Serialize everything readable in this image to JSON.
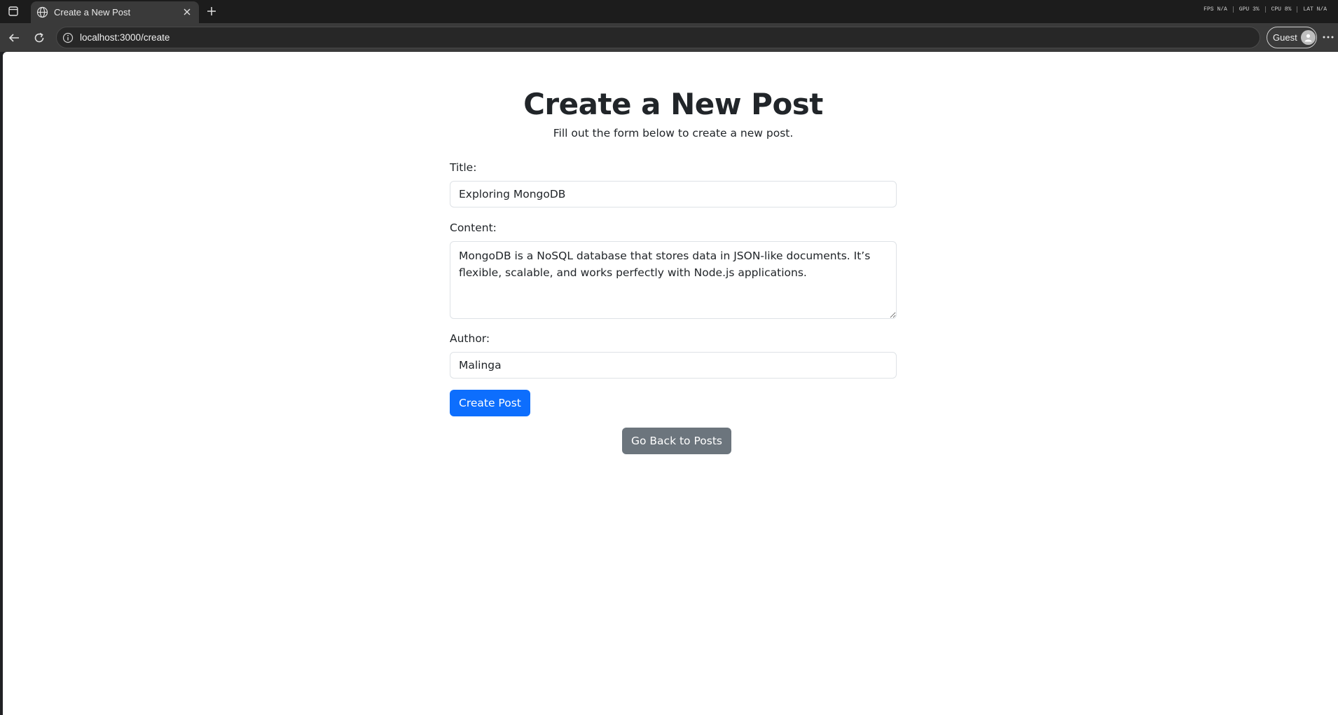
{
  "browser": {
    "tab_title": "Create a New Post",
    "url": "localhost:3000/create",
    "guest_label": "Guest",
    "stats": [
      "FPS N/A",
      "GPU 3%",
      "CPU 8%",
      "LAT N/A"
    ]
  },
  "page": {
    "heading": "Create a New Post",
    "subheading": "Fill out the form below to create a new post.",
    "form": {
      "title_label": "Title:",
      "title_value": "Exploring MongoDB",
      "content_label": "Content:",
      "content_value": "MongoDB is a NoSQL database that stores data in JSON-like documents. It’s flexible, scalable, and works perfectly with Node.js applications.",
      "author_label": "Author:",
      "author_value": "Malinga",
      "submit_label": "Create Post"
    },
    "back_button_label": "Go Back to Posts"
  },
  "colors": {
    "primary": "#0d6efd",
    "secondary": "#6c757d",
    "text": "#212529"
  }
}
